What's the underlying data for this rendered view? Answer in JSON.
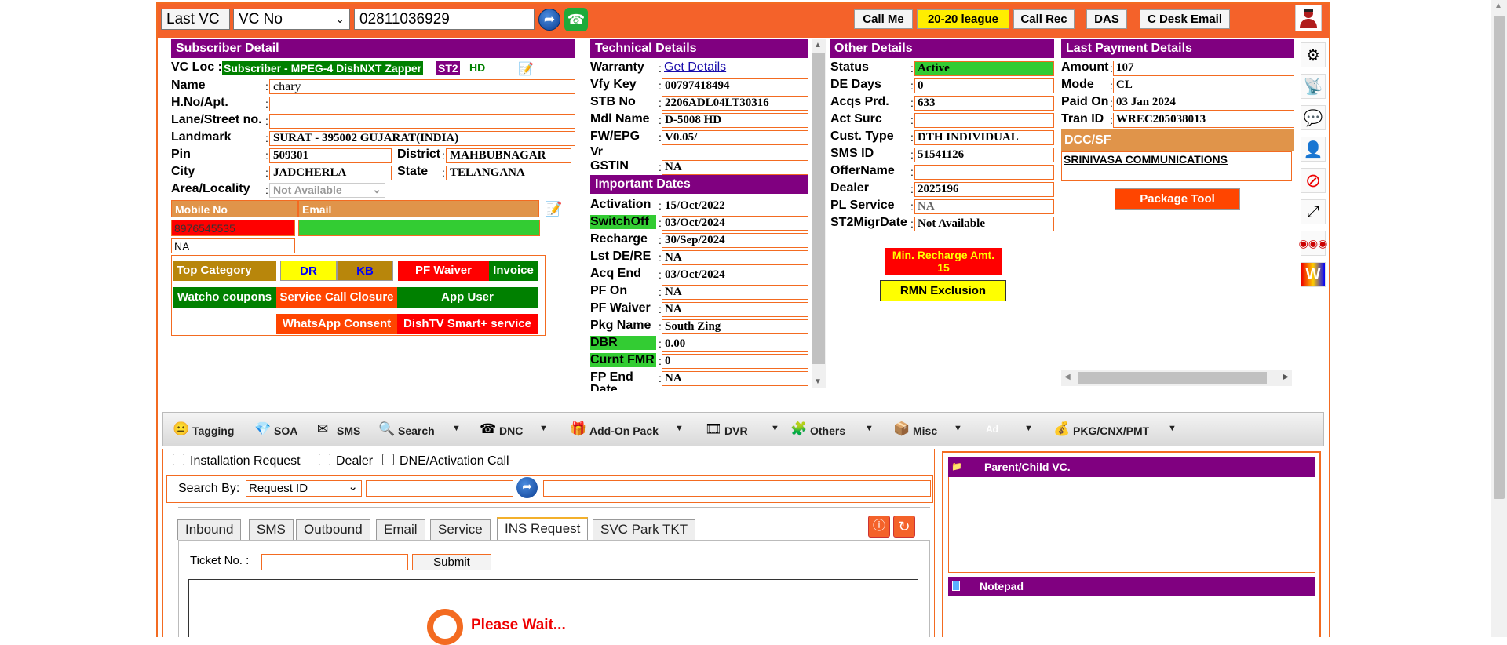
{
  "topbar": {
    "last_vc_label": "Last VC",
    "search_type": "VC No",
    "vc_number": "02811036929",
    "buttons": [
      "Call Me",
      "20-20 league",
      "Call Rec",
      "DAS",
      "C Desk Email"
    ]
  },
  "subscriber": {
    "title": "Subscriber Detail",
    "vc_loc_label": "VC Loc :",
    "vc_loc_value": "Subscriber - MPEG-4 DishNXT Zapper",
    "st2": "ST2",
    "hd": "HD",
    "name_label": "Name",
    "name": "chary",
    "hno_label": "H.No/Apt.",
    "hno": "",
    "lane_label": "Lane/Street no.",
    "lane": "",
    "landmark_label": "Landmark",
    "landmark": "SURAT - 395002 GUJARAT(INDIA)",
    "pin_label": "Pin",
    "pin": "509301",
    "district_label": "District",
    "district": "MAHBUBNAGAR",
    "city_label": "City",
    "city": "JADCHERLA",
    "state_label": "State",
    "state": "TELANGANA",
    "area_label": "Area/Locality",
    "area": "Not Available",
    "mobile_head": "Mobile No",
    "email_head": "Email",
    "mobile": "8976545535",
    "mobile2": "NA",
    "email": ""
  },
  "category_buttons": {
    "top_category": "Top Category",
    "dr": "DR",
    "kb": "KB",
    "pf_waiver": "PF Waiver",
    "invoice": "Invoice",
    "watcho": "Watcho coupons",
    "service_call": "Service Call Closure",
    "app_user": "App User",
    "whatsapp": "WhatsApp Consent",
    "smart": "DishTV Smart+ service"
  },
  "technical": {
    "title": "Technical Details",
    "rows": [
      {
        "label": "Warranty",
        "value": "Get Details"
      },
      {
        "label": "Vfy Key",
        "value": "00797418494"
      },
      {
        "label": "STB No",
        "value": "2206ADL04LT30316"
      },
      {
        "label": "Mdl Name",
        "value": "D-5008 HD"
      },
      {
        "label": "FW/EPG",
        "value": "V0.05/"
      },
      {
        "label": "Vr",
        "value": ""
      },
      {
        "label": "GSTIN",
        "value": "NA"
      }
    ]
  },
  "dates": {
    "title": "Important Dates",
    "rows": [
      {
        "label": "Activation",
        "value": "15/Oct/2022"
      },
      {
        "label": "SwitchOff",
        "value": "03/Oct/2024"
      },
      {
        "label": "Recharge",
        "value": "30/Sep/2024"
      },
      {
        "label": "Lst DE/RE",
        "value": "NA"
      },
      {
        "label": "Acq End",
        "value": "03/Oct/2024"
      },
      {
        "label": "PF On",
        "value": "NA"
      },
      {
        "label": "PF Waiver",
        "value": "NA"
      },
      {
        "label": "Pkg Name",
        "value": "South Zing"
      },
      {
        "label": "DBR",
        "value": "0.00"
      },
      {
        "label": "Curnt FMR",
        "value": "0"
      },
      {
        "label": "FP End",
        "value": "NA"
      },
      {
        "label": "Date",
        "value": ""
      }
    ]
  },
  "other": {
    "title": "Other Details",
    "rows": [
      {
        "label": "Status",
        "value": "Active"
      },
      {
        "label": "DE Days",
        "value": "0"
      },
      {
        "label": "Acqs Prd.",
        "value": "633"
      },
      {
        "label": "Act Surc",
        "value": ""
      },
      {
        "label": "Cust. Type",
        "value": "DTH INDIVIDUAL"
      },
      {
        "label": "SMS ID",
        "value": "51541126"
      },
      {
        "label": "OfferName",
        "value": ""
      },
      {
        "label": "Dealer",
        "value": "2025196"
      },
      {
        "label": "PL Service",
        "value": "NA"
      },
      {
        "label": "ST2MigrDate",
        "value": "Not Available"
      }
    ],
    "min_recharge": "Min. Recharge Amt.",
    "min_recharge_value": "15",
    "rmn": "RMN Exclusion"
  },
  "payment": {
    "title": "Last Payment Details",
    "rows": [
      {
        "label": "Amount",
        "value": "107"
      },
      {
        "label": "Mode",
        "value": "CL"
      },
      {
        "label": "Paid On",
        "value": "03 Jan 2024"
      },
      {
        "label": "Tran ID",
        "value": "WREC205038013"
      }
    ],
    "dcc_title": "DCC/SF",
    "dcc_value": "SRINIVASA COMMUNICATIONS",
    "package_tool": "Package Tool"
  },
  "menu": [
    "Tagging",
    "SOA",
    "SMS",
    "Search",
    "DNC",
    "Add-On Pack",
    "DVR",
    "Others",
    "Misc",
    "Ad",
    "PKG/CNX/PMT"
  ],
  "request": {
    "checks": [
      "Installation Request",
      "Dealer",
      "DNE/Activation Call"
    ],
    "search_by_label": "Search By:",
    "search_by_value": "Request ID",
    "tabs": [
      "Inbound",
      "SMS",
      "Outbound",
      "Email",
      "Service",
      "INS Request",
      "SVC Park TKT"
    ],
    "ticket_label": "Ticket No. :",
    "submit": "Submit",
    "wait": "Please Wait..."
  },
  "right_panels": {
    "parent_child": "Parent/Child VC.",
    "notepad": "Notepad"
  }
}
